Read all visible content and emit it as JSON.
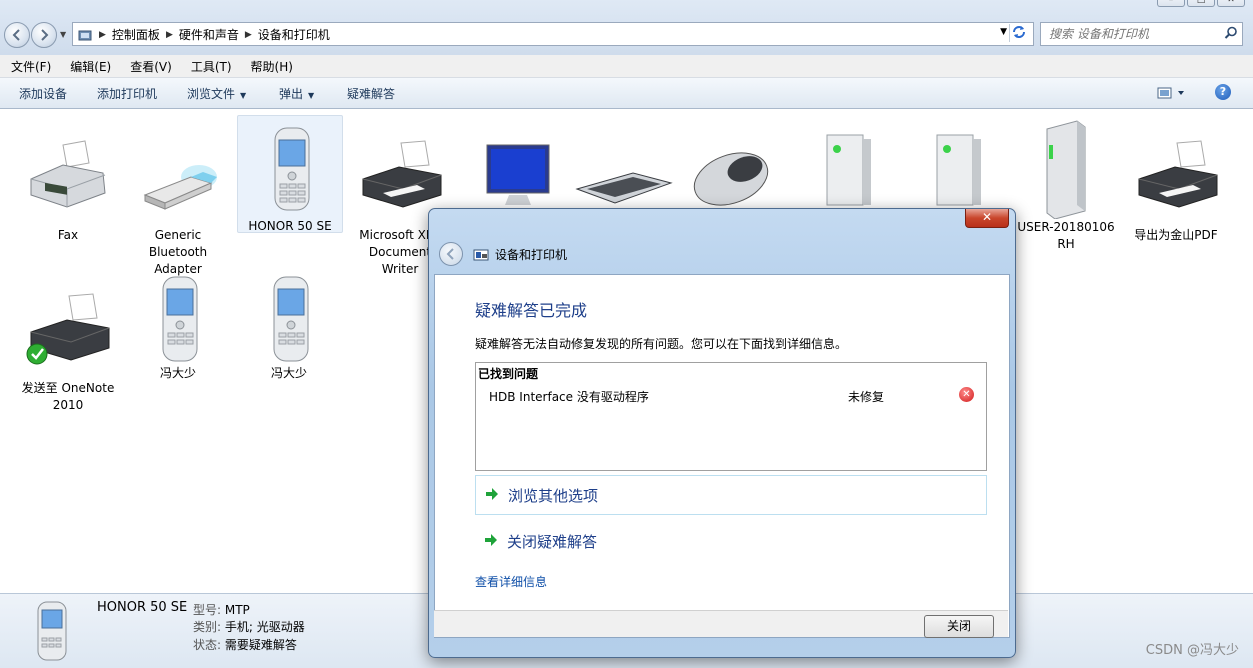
{
  "address": {
    "crumbs": [
      "控制面板",
      "硬件和声音",
      "设备和打印机"
    ],
    "search_placeholder": "搜索 设备和打印机"
  },
  "menu": [
    "文件(F)",
    "编辑(E)",
    "查看(V)",
    "工具(T)",
    "帮助(H)"
  ],
  "commands": {
    "add_device": "添加设备",
    "add_printer": "添加打印机",
    "browse_files": "浏览文件",
    "eject": "弹出",
    "troubleshoot": "疑难解答"
  },
  "devices": [
    {
      "label": "Fax",
      "icon": "fax-icon"
    },
    {
      "label": "Generic\nBluetooth\nAdapter",
      "icon": "bluetooth-adapter-icon"
    },
    {
      "label": "HONOR 50 SE",
      "icon": "phone-icon"
    },
    {
      "label": "Microsoft XPS\nDocument\nWriter",
      "icon": "printer-icon"
    },
    {
      "label": "USER-20180106\nRH",
      "icon": "computer-tower-icon"
    },
    {
      "label": "导出为金山PDF",
      "icon": "printer-icon"
    },
    {
      "label": "发送至 OneNote\n2010",
      "icon": "printer-default-icon"
    },
    {
      "label": "冯大少",
      "icon": "phone-icon"
    },
    {
      "label": "冯大少",
      "icon": "phone-icon"
    }
  ],
  "details": {
    "name": "HONOR 50 SE",
    "model_key": "型号:",
    "model_val": "MTP",
    "category_key": "类别:",
    "category_val": "手机; 光驱动器",
    "status_key": "状态:",
    "status_val": "需要疑难解答"
  },
  "dialog": {
    "title": "设备和打印机",
    "heading": "疑难解答已完成",
    "description": "疑难解答无法自动修复发现的所有问题。您可以在下面找到详细信息。",
    "issues_header": "已找到问题",
    "issue_text": "HDB Interface 没有驱动程序",
    "issue_status": "未修复",
    "option_browse": "浏览其他选项",
    "option_close": "关闭疑难解答",
    "details_link": "查看详细信息",
    "close_button": "关闭"
  },
  "watermark": "CSDN @冯大少"
}
